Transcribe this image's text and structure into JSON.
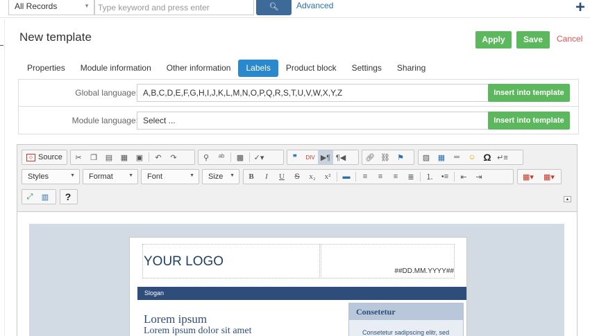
{
  "topbar": {
    "records_select": "All Records",
    "search_placeholder": "Type keyword and press enter",
    "advanced_label": "Advanced",
    "add_label": "+"
  },
  "header": {
    "title": "New template",
    "apply_label": "Apply",
    "save_label": "Save",
    "cancel_label": "Cancel"
  },
  "tabs": [
    {
      "label": "Properties",
      "active": false
    },
    {
      "label": "Module information",
      "active": false
    },
    {
      "label": "Other information",
      "active": false
    },
    {
      "label": "Labels",
      "active": true
    },
    {
      "label": "Product block",
      "active": false
    },
    {
      "label": "Settings",
      "active": false
    },
    {
      "label": "Sharing",
      "active": false
    }
  ],
  "languages": {
    "global_label": "Global language:",
    "global_value": "A,B,C,D,E,F,G,H,I,J,K,L,M,N,O,P,Q,R,S,T,U,V,W,X,Y,Z",
    "module_label": "Module language:",
    "module_value": "Select ...",
    "insert_label": "Insert into template"
  },
  "editor": {
    "source_label": "Source",
    "combos": {
      "styles": "Styles",
      "format": "Format",
      "font": "Font",
      "size": "Size"
    },
    "help_label": "?",
    "icons": [
      "source-icon",
      "cut-icon",
      "copy-icon",
      "paste-icon",
      "paste-text-icon",
      "paste-word-icon",
      "undo-icon",
      "redo-icon",
      "find-icon",
      "replace-icon",
      "select-all-icon",
      "spellcheck-icon",
      "blockquote-icon",
      "div-icon",
      "ltr-icon",
      "rtl-icon",
      "link-icon",
      "unlink-icon",
      "anchor-icon",
      "image-icon",
      "table-icon",
      "hr-icon",
      "smiley-icon",
      "special-char-icon",
      "page-break-icon",
      "bold-icon",
      "italic-icon",
      "underline-icon",
      "strike-icon",
      "subscript-icon",
      "superscript-icon",
      "remove-format-icon",
      "align-left-icon",
      "align-center-icon",
      "align-right-icon",
      "justify-icon",
      "numbered-list-icon",
      "bullet-list-icon",
      "outdent-icon",
      "indent-icon",
      "text-color-icon",
      "table-border-icon",
      "maximize-icon",
      "show-blocks-icon",
      "help-icon"
    ]
  },
  "template": {
    "logo": "YOUR LOGO",
    "date": "##DD.MM.YYYY##",
    "slogan": "Slogan",
    "lorem_title": "Lorem ipsum",
    "lorem_sub": "Lorem ipsum dolor sit amet",
    "side_head": "Consetetur",
    "side_text": "Consetetur sadipscing elitr, sed"
  }
}
